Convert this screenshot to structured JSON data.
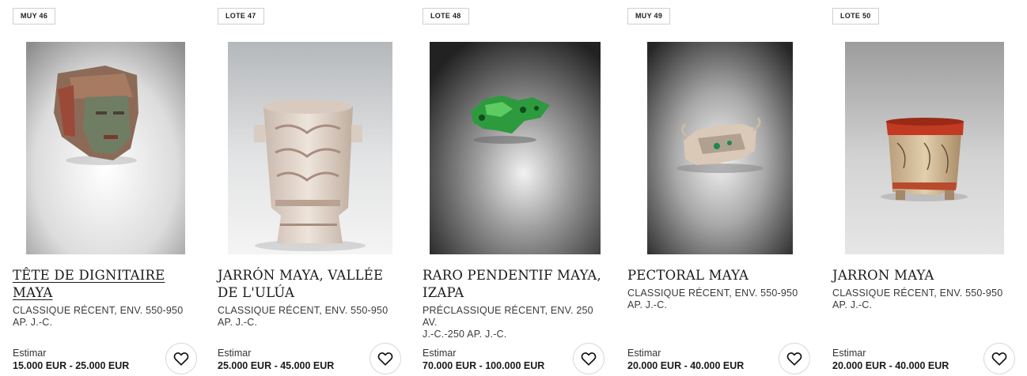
{
  "estimate_label": "Estimar",
  "lots": [
    {
      "badge": "MUY 46",
      "title_line1": "TÊTE DE DIGNITAIRE",
      "title_line2": "MAYA",
      "subtitle_line1": "CLASSIQUE RÉCENT, ENV. 550-950",
      "subtitle_line2": "AP. J.-C.",
      "estimate": "15.000 EUR - 25.000 EUR"
    },
    {
      "badge": "LOTE 47",
      "title_line1": "JARRÓN MAYA, VALLÉE",
      "title_line2": "DE L'ULÚA",
      "subtitle_line1": "CLASSIQUE RÉCENT, ENV. 550-950",
      "subtitle_line2": "AP. J.-C.",
      "estimate": "25.000 EUR - 45.000 EUR"
    },
    {
      "badge": "LOTE 48",
      "title_line1": "RARO PENDENTIF MAYA,",
      "title_line2": "IZAPA",
      "subtitle_line1": "PRÉCLASSIQUE RÉCENT, ENV. 250 AV.",
      "subtitle_line2": "J.-C.-250 AP. J.-C.",
      "estimate": "70.000 EUR - 100.000 EUR"
    },
    {
      "badge": "MUY 49",
      "title_line1": "PECTORAL MAYA",
      "title_line2": "",
      "subtitle_line1": "CLASSIQUE RÉCENT, ENV. 550-950",
      "subtitle_line2": "AP. J.-C.",
      "estimate": "20.000 EUR - 40.000 EUR"
    },
    {
      "badge": "LOTE 50",
      "title_line1": "JARRON MAYA",
      "title_line2": "",
      "subtitle_line1": "CLASSIQUE RÉCENT, ENV. 550-950",
      "subtitle_line2": "AP. J.-C.",
      "estimate": "20.000 EUR - 40.000 EUR"
    }
  ]
}
